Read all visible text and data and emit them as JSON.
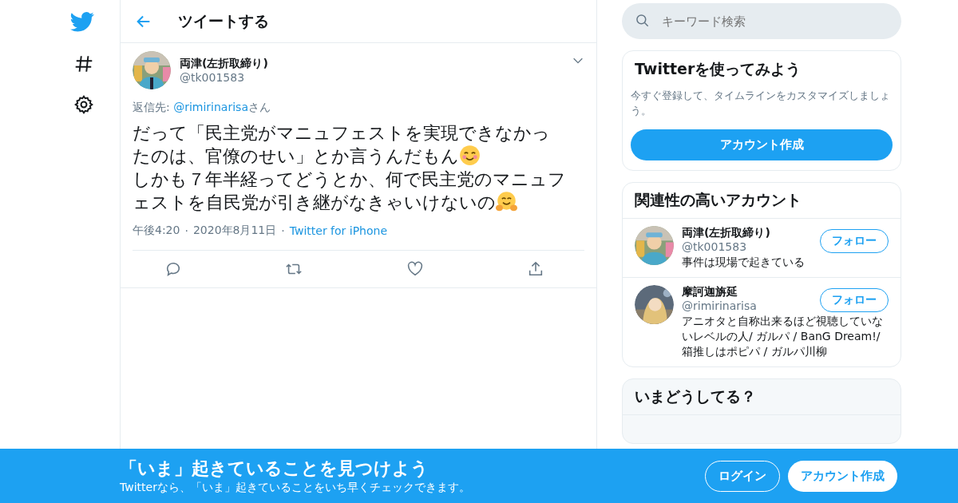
{
  "nav": {
    "items": [
      {
        "kind": "bird"
      },
      {
        "kind": "hash"
      },
      {
        "kind": "gear"
      }
    ]
  },
  "header": {
    "title": "ツイートする"
  },
  "tweet": {
    "name": "両津(左折取締り)",
    "handle": "@tk001583",
    "reply_label": "返信先:",
    "reply_to": "@rimirinarisa",
    "reply_suffix": "さん",
    "lines": [
      [
        {
          "kind": "text",
          "text": "だって「民主党がマニュフェストを実現できなかっ"
        }
      ],
      [
        {
          "kind": "text",
          "text": "たのは、官僚のせい」とか言うんだもん"
        },
        {
          "kind": "smile"
        }
      ],
      [
        {
          "kind": "text",
          "text": "しかも７年半経ってどうとか、何で民主党のマニュフ"
        }
      ],
      [
        {
          "kind": "text",
          "text": "ェストを自民党が引き継がなきゃいけないの"
        },
        {
          "kind": "hug"
        }
      ]
    ],
    "time": "午後4:20",
    "separator_1": "·",
    "date": "2020年8月11日",
    "separator_2": "·",
    "source": "Twitter for iPhone",
    "actions": [
      {
        "kind": "reply"
      },
      {
        "kind": "retweet"
      },
      {
        "kind": "like"
      },
      {
        "kind": "share"
      }
    ]
  },
  "search": {
    "placeholder": "キーワード検索"
  },
  "signup_card": {
    "title": "Twitterを使ってみよう",
    "text": "今すぐ登録して、タイムラインをカスタマイズしましょう。",
    "button": "アカウント作成"
  },
  "related": {
    "title": "関連性の高いアカウント",
    "accounts": [
      {
        "name": "両津(左折取締り)",
        "handle": "@tk001583",
        "bio": "事件は現場で起きている",
        "follow": "フォロー"
      },
      {
        "name": "摩訶迦旃延",
        "handle": "@rimirinarisa",
        "bio": "アニオタと自称出来るほど視聴していないレベルの人/ ガルパ / BanG Dream!/ 箱推しはポピパ / ガルパ川柳",
        "follow": "フォロー"
      }
    ]
  },
  "trends": {
    "title": "いまどうしてる？"
  },
  "banner": {
    "title": "「いま」起きていることを見つけよう",
    "text": "Twitterなら、「いま」起きていることをいち早くチェックできます。",
    "login": "ログイン",
    "signup": "アカウント作成"
  }
}
